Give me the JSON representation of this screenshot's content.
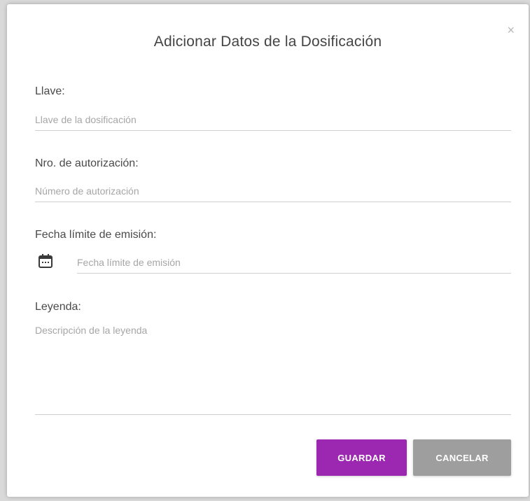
{
  "dialog": {
    "title": "Adicionar Datos de la Dosificación",
    "close_label": "×"
  },
  "fields": {
    "llave": {
      "label": "Llave:",
      "placeholder": "Llave de la dosificación",
      "value": ""
    },
    "autorizacion": {
      "label": "Nro. de autorización:",
      "placeholder": "Número de autorización",
      "value": ""
    },
    "fecha": {
      "label": "Fecha límite de emisión:",
      "placeholder": "Fecha límite de emisión",
      "value": "",
      "icon": "calendar-icon"
    },
    "leyenda": {
      "label": "Leyenda:",
      "placeholder": "Descripción de la leyenda",
      "value": ""
    }
  },
  "buttons": {
    "save_label": "GUARDAR",
    "cancel_label": "CANCELAR"
  },
  "colors": {
    "save": "#9c27b0",
    "cancel": "#9e9e9e",
    "icon": "#3a3a3a"
  }
}
